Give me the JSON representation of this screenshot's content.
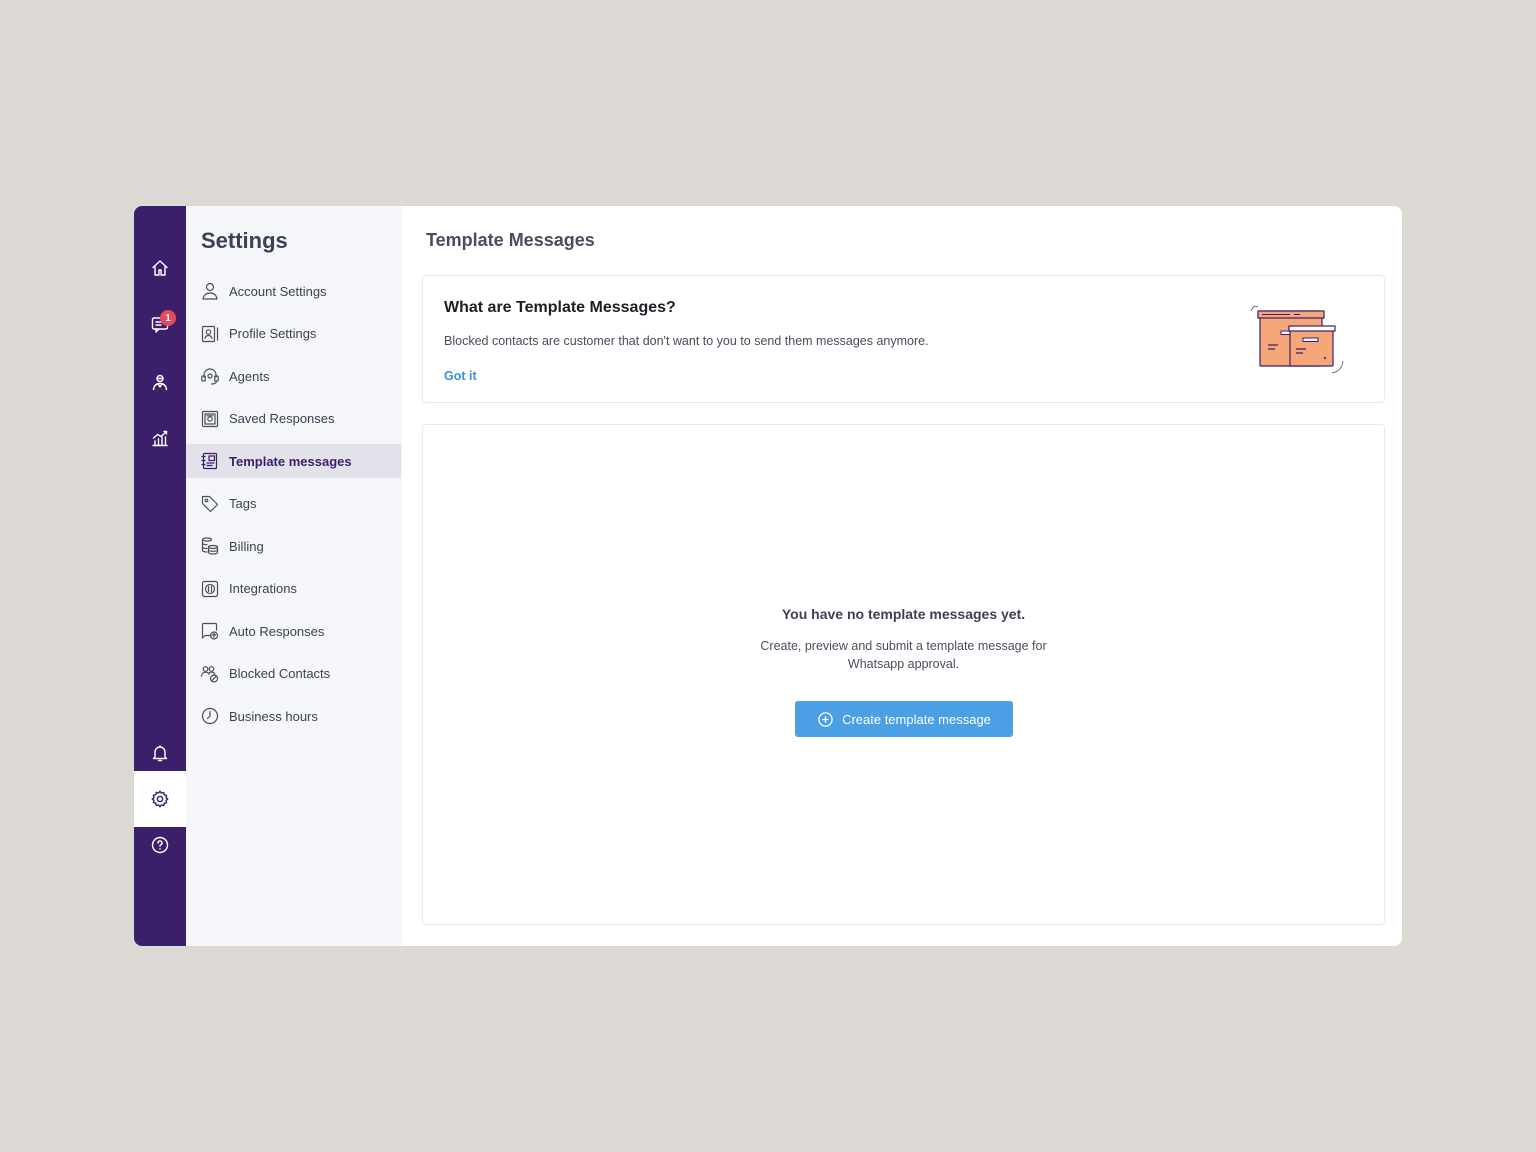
{
  "rail": {
    "items": [
      {
        "icon": "home-icon"
      },
      {
        "icon": "chat-icon",
        "badge": "1"
      },
      {
        "icon": "agent-icon"
      },
      {
        "icon": "analytics-icon"
      },
      {
        "icon": "bell-icon"
      },
      {
        "icon": "gear-icon",
        "active": true
      },
      {
        "icon": "help-icon"
      }
    ]
  },
  "sidebar": {
    "title": "Settings",
    "items": [
      {
        "label": "Account Settings",
        "icon": "user-icon"
      },
      {
        "label": "Profile Settings",
        "icon": "profile-card-icon"
      },
      {
        "label": "Agents",
        "icon": "headset-icon"
      },
      {
        "label": "Saved Responses",
        "icon": "saved-icon"
      },
      {
        "label": "Template messages",
        "icon": "template-icon",
        "active": true
      },
      {
        "label": "Tags",
        "icon": "tag-icon"
      },
      {
        "label": "Billing",
        "icon": "coins-icon"
      },
      {
        "label": "Integrations",
        "icon": "integrations-icon"
      },
      {
        "label": "Auto Responses",
        "icon": "auto-response-icon"
      },
      {
        "label": "Blocked Contacts",
        "icon": "blocked-contacts-icon"
      },
      {
        "label": "Business hours",
        "icon": "clock-icon"
      }
    ]
  },
  "main": {
    "title": "Template Messages",
    "info": {
      "title": "What are Template Messages?",
      "description": "Blocked contacts are customer that don't want to you to send them messages anymore.",
      "dismiss_label": "Got it"
    },
    "empty": {
      "title": "You have no template messages yet.",
      "description": "Create, preview and submit a template message for Whatsapp approval.",
      "button_label": "Create template message"
    }
  },
  "colors": {
    "rail": "#3b1f6b",
    "accent": "#4a9fe5",
    "link": "#3d8fd8",
    "badge": "#e8485b",
    "illustration": "#f6a77a"
  }
}
